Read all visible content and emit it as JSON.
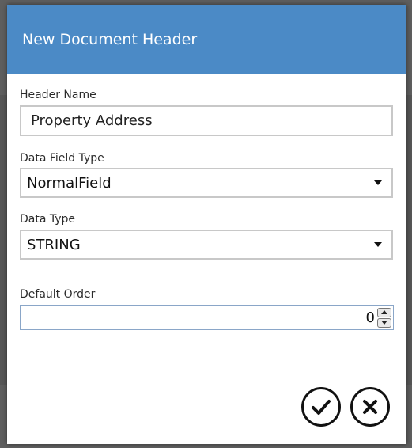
{
  "dialog": {
    "title": "New Document Header",
    "header_color": "#4b8ac6"
  },
  "fields": {
    "header_name": {
      "label": "Header Name",
      "value": "Property Address"
    },
    "data_field_type": {
      "label": "Data Field Type",
      "value": "NormalField"
    },
    "data_type": {
      "label": "Data Type",
      "value": "STRING"
    },
    "default_order": {
      "label": "Default Order",
      "value": "0"
    }
  },
  "icons": {
    "dropdown": "chevron-down-icon",
    "spinner_up": "spin-up-icon",
    "spinner_down": "spin-down-icon",
    "confirm": "checkmark-icon",
    "cancel": "close-icon"
  }
}
